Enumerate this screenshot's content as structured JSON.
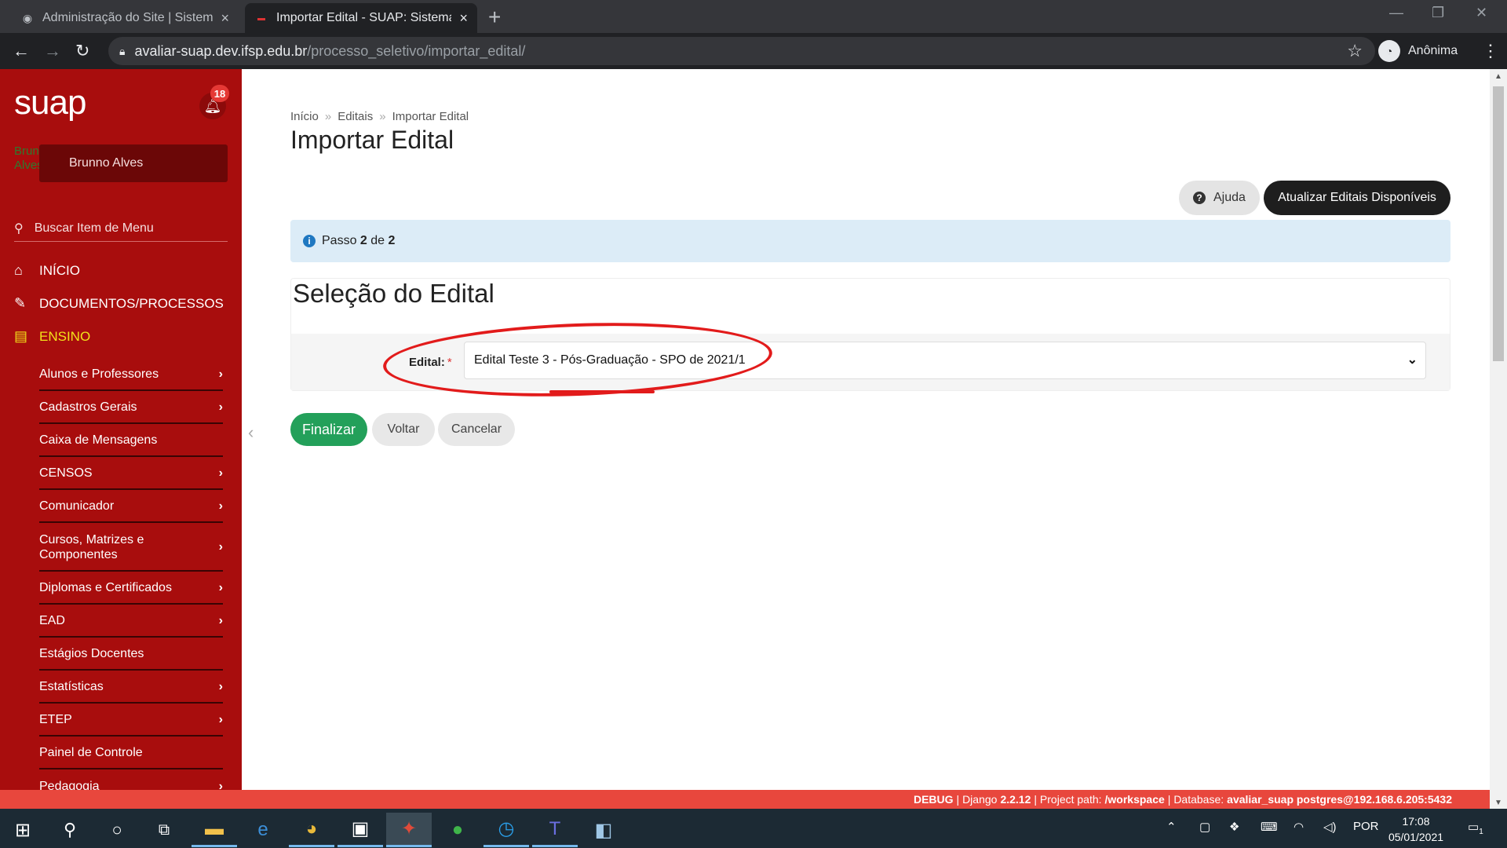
{
  "browser": {
    "tabs": [
      {
        "title": "Administração do Site | Sistema d",
        "close": "×"
      },
      {
        "title": "Importar Edital - SUAP: Sistema U",
        "close": "×"
      }
    ],
    "new_tab": "+",
    "url_host": "avaliar-suap.dev.ifsp.edu.br",
    "url_path": "/processo_seletivo/importar_edital/",
    "profile_label": "Anônima"
  },
  "sidebar": {
    "logo": "suap",
    "notification_count": "18",
    "user_photo_alt": "Brunno Alves",
    "user_name": "Brunno Alves",
    "search_placeholder": "Buscar Item de Menu",
    "top_items": [
      {
        "label": "INÍCIO",
        "icon": "home-icon"
      },
      {
        "label": "DOCUMENTOS/PROCESSOS",
        "icon": "edit-icon"
      },
      {
        "label": "ENSINO",
        "icon": "teaching-icon"
      }
    ],
    "sub_items": [
      {
        "label": "Alunos e Professores",
        "chevron": "›"
      },
      {
        "label": "Cadastros Gerais",
        "chevron": "›"
      },
      {
        "label": "Caixa de Mensagens",
        "chevron": ""
      },
      {
        "label": "CENSOS",
        "chevron": "›"
      },
      {
        "label": "Comunicador",
        "chevron": "›"
      },
      {
        "label": "Cursos, Matrizes e Componentes",
        "chevron": "›"
      },
      {
        "label": "Diplomas e Certificados",
        "chevron": "›"
      },
      {
        "label": "EAD",
        "chevron": "›"
      },
      {
        "label": "Estágios Docentes",
        "chevron": ""
      },
      {
        "label": "Estatísticas",
        "chevron": "›"
      },
      {
        "label": "ETEP",
        "chevron": "›"
      },
      {
        "label": "Painel de Controle",
        "chevron": ""
      },
      {
        "label": "Pedagogia",
        "chevron": "›"
      }
    ]
  },
  "main": {
    "breadcrumb": [
      "Início",
      "Editais",
      "Importar Edital"
    ],
    "breadcrumb_sep": "»",
    "title": "Importar Edital",
    "help_label": "Ajuda",
    "update_label": "Atualizar Editais Disponíveis",
    "step": {
      "prefix": "Passo",
      "current": "2",
      "middle": "de",
      "total": "2"
    },
    "section_title": "Seleção do Edital",
    "field_label": "Edital:",
    "field_required": "*",
    "select_value": "Edital Teste 3 - Pós-Graduação - SPO de 2021/1",
    "buttons": {
      "finish": "Finalizar",
      "back": "Voltar",
      "cancel": "Cancelar"
    }
  },
  "debug": {
    "debug_label": "DEBUG",
    "django_prefix": "| Django",
    "django_version": "2.2.12",
    "project_prefix": "| Project path:",
    "project_path": "/workspace",
    "db_prefix": "| Database:",
    "database": "avaliar_suap postgres@192.168.6.205:5432"
  },
  "taskbar": {
    "language": "POR",
    "time": "17:08",
    "date": "05/01/2021",
    "notifications": "1"
  },
  "colors": {
    "sidebar": "#a80d0d",
    "accent_yellow": "#f2e21a",
    "finish_green": "#23a05a",
    "alert_bg": "#dcecf7",
    "debug_bar": "#e8473d",
    "annotation_red": "#e21b1b"
  }
}
